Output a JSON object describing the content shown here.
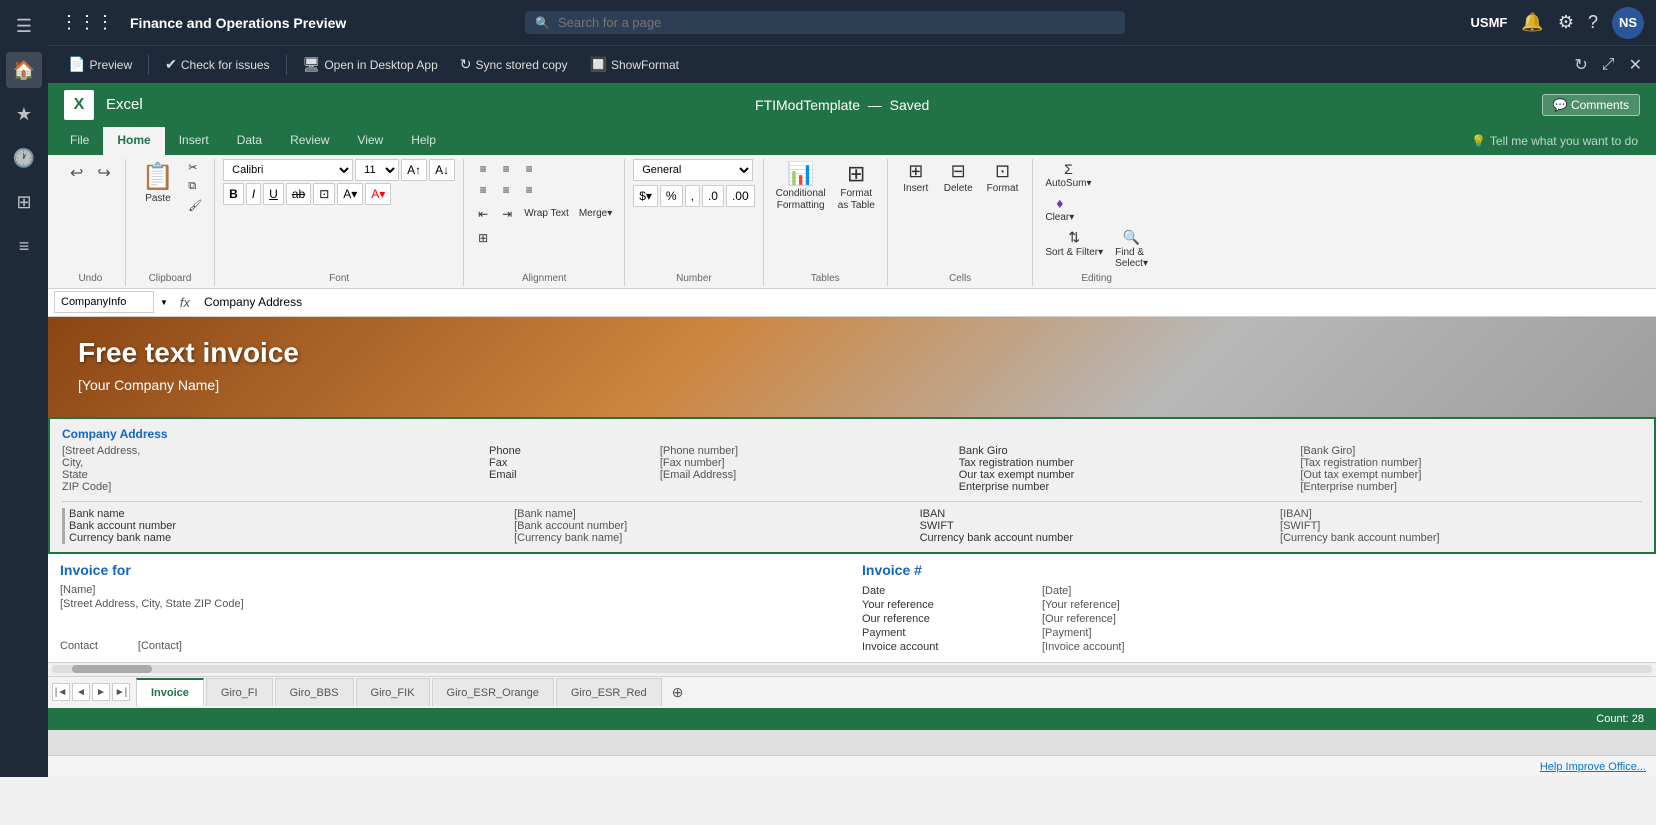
{
  "app": {
    "title": "Finance and Operations Preview",
    "org": "USMF",
    "search_placeholder": "Search for a page"
  },
  "toolbar2": {
    "preview_label": "Preview",
    "check_issues_label": "Check for issues",
    "open_desktop_label": "Open in Desktop App",
    "sync_label": "Sync stored copy",
    "showformat_label": "ShowFormat"
  },
  "excel": {
    "app_name": "Excel",
    "file_name": "FTIModTemplate",
    "save_status": "Saved",
    "comments_label": "Comments"
  },
  "ribbon": {
    "tabs": [
      "File",
      "Home",
      "Insert",
      "Data",
      "Review",
      "View",
      "Help"
    ],
    "active_tab": "Home",
    "tell_me": "Tell me what you want to do",
    "clipboard_label": "Clipboard",
    "undo_label": "Undo",
    "font_label": "Font",
    "alignment_label": "Alignment",
    "number_label": "Number",
    "tables_label": "Tables",
    "cells_label": "Cells",
    "editing_label": "Editing"
  },
  "formula_bar": {
    "cell_ref": "CompanyInfo",
    "formula": "Company Address"
  },
  "font": {
    "name": "Calibri",
    "size": "11"
  },
  "number_format": {
    "value": "General"
  },
  "buttons": {
    "bold": "B",
    "italic": "I",
    "underline": "U",
    "strikethrough": "ab",
    "paste": "Paste",
    "cut": "✂",
    "copy": "⧉",
    "format_painter": "🖌",
    "increase_font": "A↑",
    "decrease_font": "A↓",
    "undo": "↩",
    "redo": "↪"
  },
  "toolbar_groups": {
    "conditional_formatting": "Conditional\nFormatting",
    "format_as_table": "Format\nas Table",
    "insert_label": "Insert",
    "delete_label": "Delete",
    "format_label": "Format",
    "autosum_label": "AutoSum",
    "clear_label": "Clear",
    "sort_filter_label": "Sort &\nFilter",
    "find_select_label": "Find &\nSelect"
  },
  "invoice": {
    "header_title": "Free text invoice",
    "company_placeholder": "[Your Company Name]",
    "company_address_title": "Company Address",
    "street": "[Street Address,",
    "city": "City,",
    "state": "State",
    "zip": "ZIP Code]",
    "fields": {
      "phone_label": "Phone",
      "phone_value": "[Phone number]",
      "fax_label": "Fax",
      "fax_value": "[Fax number]",
      "email_label": "Email",
      "email_value": "[Email Address]",
      "bank_giro_label": "Bank Giro",
      "bank_giro_value": "[Bank Giro]",
      "tax_reg_label": "Tax registration number",
      "tax_reg_value": "[Tax registration number]",
      "tax_exempt_label": "Our tax exempt number",
      "tax_exempt_value": "[Out tax exempt number]",
      "enterprise_label": "Enterprise number",
      "enterprise_value": "[Enterprise number]",
      "bank_name_label": "Bank name",
      "bank_name_value": "[Bank name]",
      "bank_acct_label": "Bank account number",
      "bank_acct_value": "[Bank account number]",
      "bank_curr_label": "Currency bank name",
      "bank_curr_value": "[Currency bank name]",
      "iban_label": "IBAN",
      "iban_value": "[IBAN]",
      "swift_label": "SWIFT",
      "swift_value": "[SWIFT]",
      "curr_bank_acct_label": "Currency bank account number",
      "curr_bank_acct_value": "[Currency bank account number]"
    },
    "invoice_for": {
      "title": "Invoice for",
      "name": "[Name]",
      "address": "[Street Address, City, State ZIP Code]",
      "contact_label": "Contact",
      "contact_value": "[Contact]"
    },
    "invoice_num": {
      "title": "Invoice #",
      "date_label": "Date",
      "date_value": "[Date]",
      "your_ref_label": "Your reference",
      "your_ref_value": "[Your reference]",
      "our_ref_label": "Our reference",
      "our_ref_value": "[Our reference]",
      "payment_label": "Payment",
      "payment_value": "[Payment]",
      "inv_acct_label": "Invoice account",
      "inv_acct_value": "[Invoice account]"
    }
  },
  "sheet_tabs": [
    "Invoice",
    "Giro_FI",
    "Giro_BBS",
    "Giro_FIK",
    "Giro_ESR_Orange",
    "Giro_ESR_Red"
  ],
  "active_sheet": "Invoice",
  "status_bar": {
    "count_label": "Count: 28"
  },
  "bottom_bar": {
    "improve_label": "Help Improve Office..."
  }
}
